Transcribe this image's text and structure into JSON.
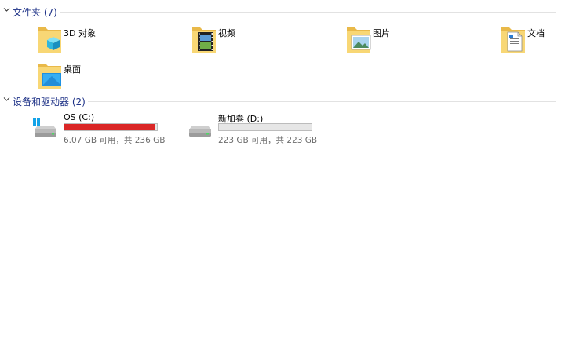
{
  "folders_group": {
    "title": "文件夹 (7)",
    "items": [
      {
        "label": "3D 对象",
        "icon": "3d-objects-folder-icon"
      },
      {
        "label": "视频",
        "icon": "videos-folder-icon"
      },
      {
        "label": "图片",
        "icon": "pictures-folder-icon"
      },
      {
        "label": "文档",
        "icon": "documents-folder-icon"
      },
      {
        "label": "桌面",
        "icon": "desktop-folder-icon"
      }
    ]
  },
  "drives_group": {
    "title": "设备和驱动器 (2)",
    "items": [
      {
        "name": "OS (C:)",
        "space": "6.07 GB 可用，共 236 GB",
        "used_fraction": 0.974,
        "bar_color": "#da2626",
        "icon": "windows-drive-icon"
      },
      {
        "name": "新加卷 (D:)",
        "space": "223 GB 可用，共 223 GB",
        "used_fraction": 0.0,
        "bar_color": "#26a0da",
        "icon": "hard-drive-icon"
      }
    ]
  },
  "colors": {
    "group_title": "#1e3287",
    "folder": "#f8d775",
    "drive_full": "#da2626"
  }
}
